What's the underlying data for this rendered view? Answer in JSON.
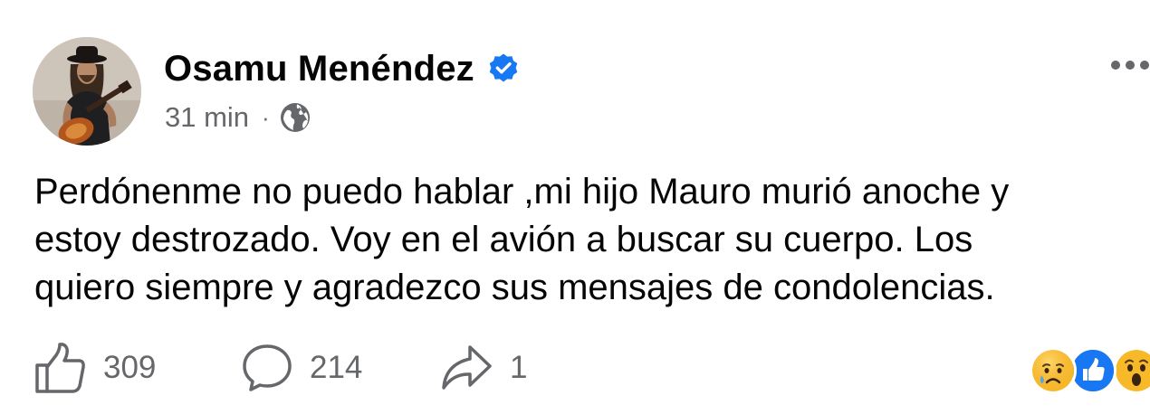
{
  "post": {
    "author": {
      "name": "Osamu Menéndez",
      "verified": true
    },
    "time": "31 min",
    "separator": "·",
    "audience_icon": "globe-icon",
    "text": "Perdónenme no puedo hablar ,mi hijo Mauro murió anoche y\nestoy destrozado. Voy en el avión a buscar su cuerpo. Los\nquiero siempre y agradezco sus mensajes de condolencias.",
    "actions": {
      "likes": "309",
      "comments": "214",
      "shares": "1"
    },
    "reactions": [
      "sad-reaction-icon",
      "like-reaction-icon",
      "wow-reaction-icon"
    ]
  },
  "colors": {
    "verified_blue": "#1877f2",
    "secondary_text": "#65676b",
    "primary_text": "#050505",
    "reaction_yellow": "#f7b928"
  }
}
